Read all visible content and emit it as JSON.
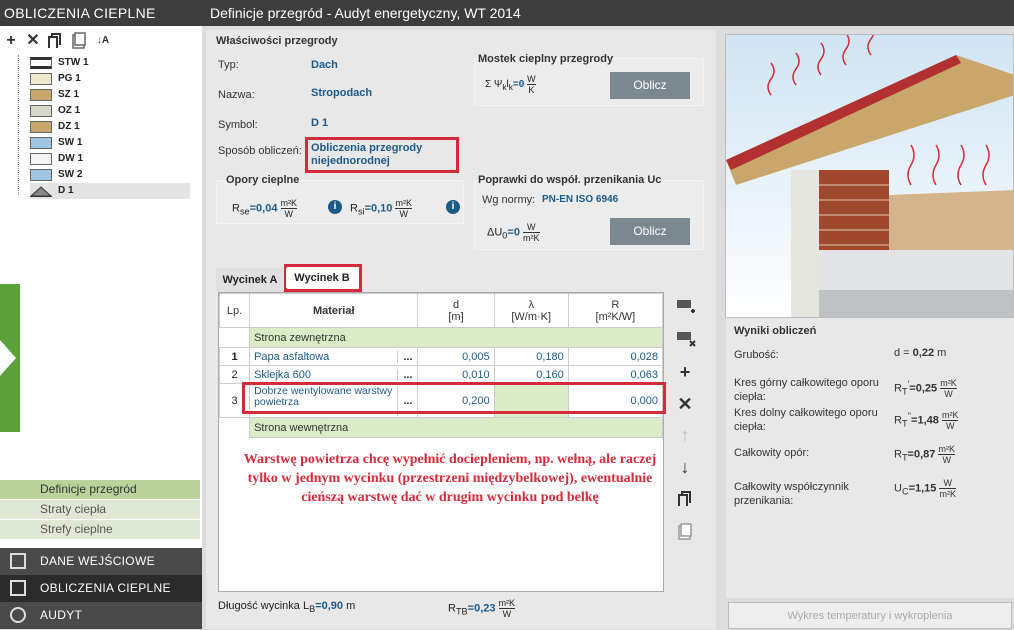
{
  "left": {
    "title": "OBLICZENIA CIEPLNE",
    "toolbar": [
      "plus-icon",
      "close-icon",
      "copy-layer-icon",
      "document-icon",
      "sort-icon"
    ],
    "tree": [
      {
        "label": "STW 1"
      },
      {
        "label": "PG 1"
      },
      {
        "label": "SZ 1"
      },
      {
        "label": "OZ 1"
      },
      {
        "label": "DZ 1"
      },
      {
        "label": "SW 1"
      },
      {
        "label": "DW 1"
      },
      {
        "label": "SW 2"
      },
      {
        "label": "D 1"
      }
    ],
    "sub_nav": [
      "Definicje przegród",
      "Straty ciepła",
      "Strefy cieplne"
    ],
    "main_nav": [
      "DANE WEJŚCIOWE",
      "OBLICZENIA CIEPLNE",
      "AUDYT"
    ]
  },
  "main": {
    "title": "Definicje przegród - Audyt energetyczny, WT 2014",
    "props": {
      "heading": "Właściwości przegrody",
      "typ_label": "Typ:",
      "typ_value": "Dach",
      "nazwa_label": "Nazwa:",
      "nazwa_value": "Stropodach",
      "symbol_label": "Symbol:",
      "symbol_value": "D 1",
      "sposob_label": "Sposób obliczeń:",
      "sposob_value_1": "Obliczenia przegrody",
      "sposob_value_2": "niejednorodnej"
    },
    "opory": {
      "heading": "Opory cieplne",
      "rse_label": "R",
      "rse_sub": "se",
      "rse_value": "=0,04",
      "rsi_label": "R",
      "rsi_sub": "si",
      "rsi_value": "=0,10",
      "unit_top": "m²K",
      "unit_bottom": "W",
      "info": "i"
    },
    "mostek": {
      "heading": "Mostek cieplny przegrody",
      "formula": "Σ Ψ",
      "formula_sub": "k",
      "formula_tail": "l",
      "formula_tail_sub": "k",
      "value": "=0",
      "unit_top": "W",
      "unit_bottom": "K",
      "button": "Oblicz"
    },
    "poprawki": {
      "heading": "Poprawki do współ. przenikania Uc",
      "norm_label": "Wg normy:",
      "norm_value": "PN-EN ISO 6946",
      "du_label": "ΔU",
      "du_sub": "0",
      "du_value": "=0",
      "unit_top": "W",
      "unit_bottom": "m²K",
      "button": "Oblicz"
    },
    "tabs": [
      "Wycinek A",
      "Wycinek B"
    ],
    "table": {
      "headers": [
        "Lp.",
        "Materiał",
        "d",
        "λ",
        "R"
      ],
      "units": [
        "",
        "",
        "[m]",
        "[W/m·K]",
        "[m²K/W]"
      ],
      "strona_zewnetrzna": "Strona zewnętrzna",
      "strona_wewnetrzna": "Strona wewnętrzna",
      "rows": [
        {
          "lp": "1",
          "name": "Papa asfaltowa",
          "d": "0,005",
          "lambda": "0,180",
          "r": "0,028"
        },
        {
          "lp": "2",
          "name": "Sklejka 600",
          "d": "0,010",
          "lambda": "0,160",
          "r": "0,063"
        },
        {
          "lp": "3",
          "name": "Dobrze wentylowane warstwy powietrza",
          "d": "0,200",
          "lambda": "",
          "r": "0,000"
        }
      ],
      "dots": "..."
    },
    "annotation": "Warstwę powietrza chcę wypełnić dociepleniem, np. wełną, ale raczej tylko w jednym wycinku (przestrzeni międzybelkowej), ewentualnie cieńszą warstwę dać w drugim wycinku pod belkę",
    "bottom": {
      "dl_label": "Długość wycinka L",
      "dl_sub": "B",
      "dl_value": "=0,90",
      "dl_unit": "m",
      "rtb_label": "R",
      "rtb_sub": "TB",
      "rtb_value": "=0,23",
      "unit_top": "m²K",
      "unit_bottom": "W"
    }
  },
  "results": {
    "heading": "Wyniki obliczeń",
    "grubosc_label": "Grubość:",
    "grubosc_sym": "d =",
    "grubosc_value": "0,22",
    "grubosc_unit": "m",
    "kres_gorny_label": "Kres górny całkowitego oporu ciepła:",
    "kres_gorny_sym": "R",
    "kres_gorny_sub": "T",
    "kres_gorny_sup": "'",
    "kres_gorny_value": "=0,25",
    "kres_dolny_label": "Kres dolny całkowitego oporu ciepła:",
    "kres_dolny_sym": "R",
    "kres_dolny_sub": "T",
    "kres_dolny_sup": "''",
    "kres_dolny_value": "=1,48",
    "calkowity_label": "Całkowity opór:",
    "calkowity_sym": "R",
    "calkowity_sub": "T",
    "calkowity_value": "=0,87",
    "wspolczynnik_label": "Całkowity współczynnik przenikania:",
    "wspolczynnik_sym": "U",
    "wspolczynnik_sub": "C",
    "wspolczynnik_value": "=1,15",
    "unit_r_top": "m²K",
    "unit_r_bottom": "W",
    "unit_u_top": "W",
    "unit_u_bottom": "m²K",
    "chart_button": "Wykres temperatury i wykroplenia"
  },
  "colors": {
    "accent_red": "#d42a3a",
    "value_blue": "#1b5a8a",
    "green_row": "#d9ecc6",
    "nav_dark": "#3d3d3d"
  }
}
